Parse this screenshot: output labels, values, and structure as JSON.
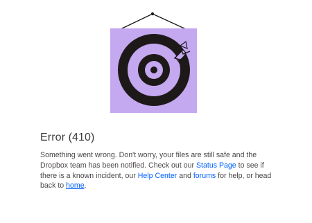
{
  "error": {
    "title": "Error (410)",
    "message_part1": "Something went wrong. Don't worry, your files are still safe and the Dropbox team has been notified. Check out our ",
    "status_page_link": "Status Page",
    "message_part2": " to see if there is a known incident, our ",
    "help_center_link": "Help Center",
    "message_part3": " and ",
    "forums_link": "forums",
    "message_part4": " for help, or head back to ",
    "home_link": "home",
    "message_end": "."
  },
  "colors": {
    "link": "#0061fe",
    "poster_background": "#c4a8f0",
    "target": "#1e1919"
  },
  "illustration": {
    "icon": "target-with-arrow-poster"
  }
}
